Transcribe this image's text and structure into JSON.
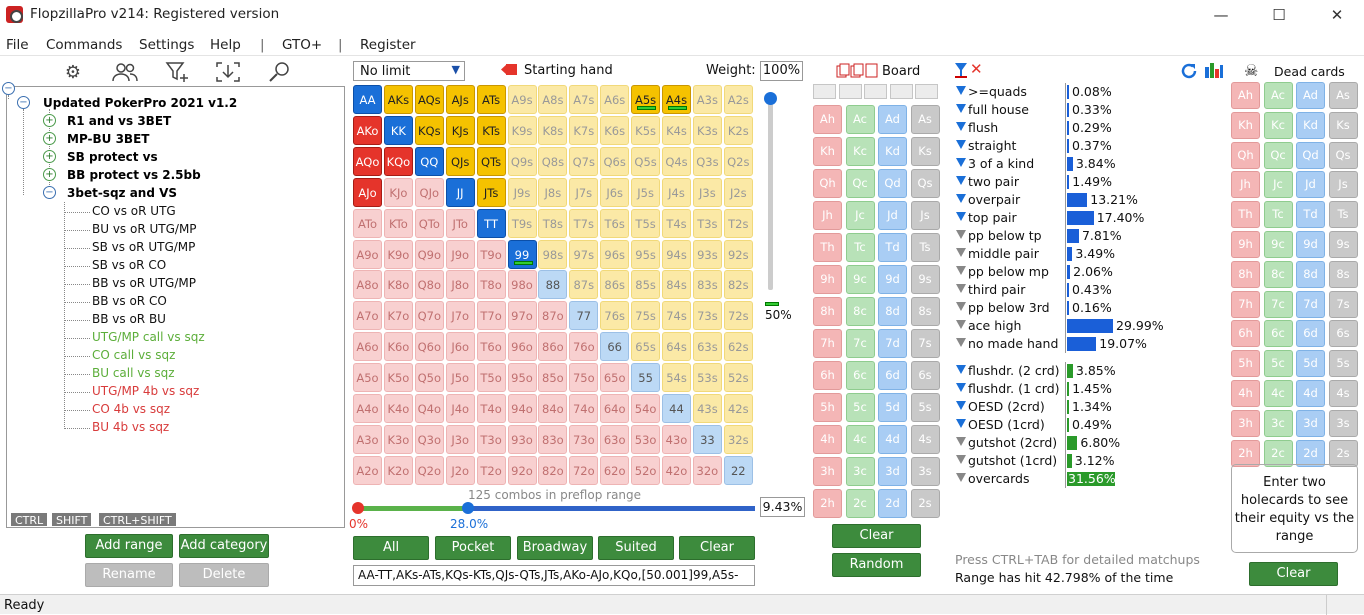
{
  "window": {
    "title": "FlopzillaPro v214: Registered version",
    "minimize": "—",
    "maximize": "☐",
    "close": "✕"
  },
  "menu": [
    "File",
    "Commands",
    "Settings",
    "Help",
    "|",
    "GTO+",
    "|",
    "Register"
  ],
  "toolbar_icons": [
    "gear-icon",
    "users-icon",
    "filter-plus-icon",
    "import-icon",
    "search-icon"
  ],
  "tree": {
    "root": "Updated PokerPro 2021 v1.2",
    "groups": [
      {
        "label": "R1 and vs 3BET",
        "expanded": false
      },
      {
        "label": "MP-BU 3BET",
        "expanded": false
      },
      {
        "label": "SB protect vs",
        "expanded": false
      },
      {
        "label": "BB protect vs 2.5bb",
        "expanded": false
      },
      {
        "label": "3bet-sqz and VS",
        "expanded": true
      }
    ],
    "leaves": [
      {
        "label": "CO vs oR UTG",
        "color": "#111111"
      },
      {
        "label": "BU vs oR UTG/MP",
        "color": "#111111"
      },
      {
        "label": "SB vs oR UTG/MP",
        "color": "#111111"
      },
      {
        "label": "SB vs oR CO",
        "color": "#111111"
      },
      {
        "label": "BB vs oR UTG/MP",
        "color": "#111111"
      },
      {
        "label": "BB vs oR CO",
        "color": "#111111"
      },
      {
        "label": "BB vs oR BU",
        "color": "#111111"
      },
      {
        "label": "UTG/MP call vs sqz",
        "color": "#5cae3a"
      },
      {
        "label": "CO call vs sqz",
        "color": "#5cae3a"
      },
      {
        "label": "BU call vs sqz",
        "color": "#5cae3a"
      },
      {
        "label": "UTG/MP 4b vs sqz",
        "color": "#d83b3b"
      },
      {
        "label": "CO 4b vs sqz",
        "color": "#d83b3b"
      },
      {
        "label": "BU 4b vs sqz",
        "color": "#d83b3b"
      }
    ],
    "tabs": [
      "CTRL",
      "SHIFT",
      "CTRL+SHIFT"
    ]
  },
  "left_buttons": {
    "add_range": "Add range",
    "add_category": "Add category",
    "rename": "Rename",
    "delete": "Delete"
  },
  "range": {
    "game_type": "No limit",
    "starting_hand_label": "Starting hand",
    "weight_label": "Weight:",
    "weight_value": "100%",
    "weight_min": "50%",
    "combos_text": "125 combos in preflop range",
    "slider_min": "0%",
    "slider_value": "28.0%",
    "percent": "9.43%",
    "range_text": "AA-TT,AKs-ATs,KQs-KTs,QJs-QTs,JTs,AKo-AJo,KQo,[50.001]99,A5s-",
    "buttons": [
      "All",
      "Pocket",
      "Broadway",
      "Suited",
      "Clear"
    ],
    "ranks": [
      "A",
      "K",
      "Q",
      "J",
      "T",
      "9",
      "8",
      "7",
      "6",
      "5",
      "4",
      "3",
      "2"
    ],
    "selected": [
      "AA",
      "AKs",
      "AQs",
      "AJs",
      "ATs",
      "A5s",
      "A4s",
      "KK",
      "KQs",
      "KJs",
      "KTs",
      "QQ",
      "QJs",
      "QTs",
      "JJ",
      "JTs",
      "TT",
      "99",
      "AKo",
      "AQo",
      "AJo",
      "KQo"
    ],
    "weighted": [
      "A5s",
      "A4s",
      "99"
    ]
  },
  "board": {
    "title": "Board",
    "slots": 5,
    "suits": [
      "h",
      "c",
      "d",
      "s"
    ],
    "clear": "Clear",
    "random": "Random"
  },
  "stats": {
    "made": [
      {
        "label": ">=quads",
        "pct": "0.08%",
        "value": 0.08
      },
      {
        "label": "full house",
        "pct": "0.33%",
        "value": 0.33
      },
      {
        "label": "flush",
        "pct": "0.29%",
        "value": 0.29
      },
      {
        "label": "straight",
        "pct": "0.37%",
        "value": 0.37
      },
      {
        "label": "3 of a kind",
        "pct": "3.84%",
        "value": 3.84
      },
      {
        "label": "two pair",
        "pct": "1.49%",
        "value": 1.49
      },
      {
        "label": "overpair",
        "pct": "13.21%",
        "value": 13.21
      },
      {
        "label": "top pair",
        "pct": "17.40%",
        "value": 17.4
      },
      {
        "label": "pp below tp",
        "pct": "7.81%",
        "value": 7.81
      },
      {
        "label": "middle pair",
        "pct": "3.49%",
        "value": 3.49
      },
      {
        "label": "pp below mp",
        "pct": "2.06%",
        "value": 2.06
      },
      {
        "label": "third pair",
        "pct": "0.43%",
        "value": 0.43
      },
      {
        "label": "pp below 3rd",
        "pct": "0.16%",
        "value": 0.16
      },
      {
        "label": "ace high",
        "pct": "29.99%",
        "value": 29.99
      },
      {
        "label": "no made hand",
        "pct": "19.07%",
        "value": 19.07
      }
    ],
    "draws": [
      {
        "label": "flushdr. (2 crd)",
        "pct": "3.85%",
        "value": 3.85
      },
      {
        "label": "flushdr. (1 crd)",
        "pct": "1.45%",
        "value": 1.45
      },
      {
        "label": "OESD (2crd)",
        "pct": "1.34%",
        "value": 1.34
      },
      {
        "label": "OESD (1crd)",
        "pct": "0.49%",
        "value": 0.49
      },
      {
        "label": "gutshot (2crd)",
        "pct": "6.80%",
        "value": 6.8
      },
      {
        "label": "gutshot (1crd)",
        "pct": "3.12%",
        "value": 3.12
      },
      {
        "label": "overcards",
        "pct": "31.56%",
        "value": 31.56
      }
    ],
    "hint": "Press CTRL+TAB for detailed matchups",
    "range_hit": "Range has hit 42.798% of the time"
  },
  "dead": {
    "title": "Dead cards",
    "help": "Enter two holecards to see their equity vs the range",
    "clear": "Clear"
  },
  "colors": {
    "selected": "#f5c200",
    "pair_selected": "#1a6fd8",
    "offsuit_selected": "#e5342b",
    "hearts": "#f4b6b6",
    "clubs": "#b8e2b8",
    "diamonds": "#a9cdf4",
    "spades": "#c9c9c9"
  },
  "status": "Ready"
}
